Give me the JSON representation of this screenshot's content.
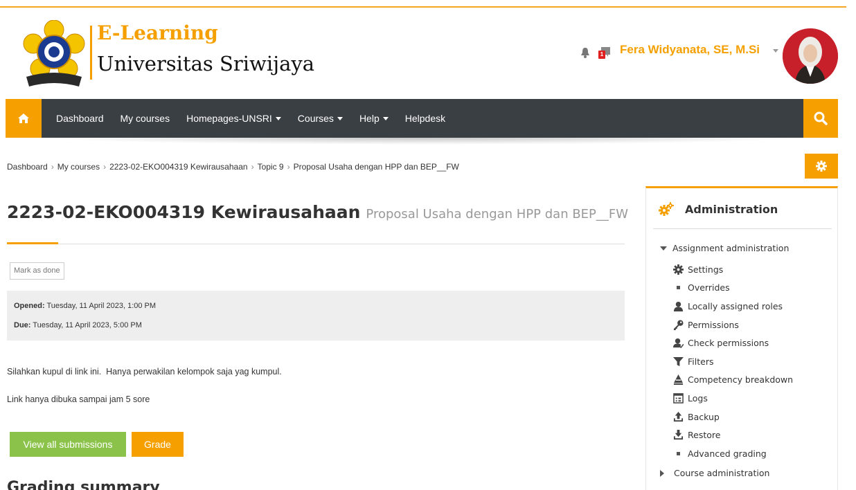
{
  "brand": {
    "title": "E-Learning",
    "subtitle": "Universitas  Sriwijaya",
    "logo_motto": "ILMU ALAT PENGABDIAN"
  },
  "header": {
    "message_badge": "1",
    "user_name": "Fera Widyanata, SE, M.Si"
  },
  "nav": {
    "items": [
      {
        "label": "Dashboard",
        "dropdown": false
      },
      {
        "label": "My courses",
        "dropdown": false
      },
      {
        "label": "Homepages-UNSRI",
        "dropdown": true
      },
      {
        "label": "Courses",
        "dropdown": true
      },
      {
        "label": "Help",
        "dropdown": true
      },
      {
        "label": "Helpdesk",
        "dropdown": false
      }
    ]
  },
  "breadcrumb": [
    "Dashboard",
    "My courses",
    "2223-02-EKO004319 Kewirausahaan",
    "Topic 9",
    "Proposal Usaha dengan HPP dan BEP__FW"
  ],
  "page": {
    "course_name": "2223-02-EKO004319 Kewirausahaan",
    "activity_name": "Proposal Usaha dengan HPP dan BEP__FW",
    "mark_done": "Mark as done",
    "opened_label": "Opened:",
    "opened_value": " Tuesday, 11 April 2023, 1:00 PM",
    "due_label": "Due:",
    "due_value": " Tuesday, 11 April 2023, 5:00 PM",
    "intro_1": "Silahkan kupul di link ini.  Hanya perwakilan kelompok saja yag kumpul.",
    "intro_2": "Link hanya dibuka sampai jam 5 sore",
    "btn_view_all": "View all submissions",
    "btn_grade": "Grade",
    "grading_summary": "Grading summary"
  },
  "admin": {
    "title": "Administration",
    "section": "Assignment administration",
    "items": [
      {
        "label": "Settings",
        "icon": "gear-icon"
      },
      {
        "label": "Overrides",
        "icon": "bullet"
      },
      {
        "label": "Locally assigned roles",
        "icon": "user-icon"
      },
      {
        "label": "Permissions",
        "icon": "key-icon"
      },
      {
        "label": "Check permissions",
        "icon": "user-check-icon"
      },
      {
        "label": "Filters",
        "icon": "filter-icon"
      },
      {
        "label": "Competency breakdown",
        "icon": "competency-icon"
      },
      {
        "label": "Logs",
        "icon": "logs-icon"
      },
      {
        "label": "Backup",
        "icon": "upload-icon"
      },
      {
        "label": "Restore",
        "icon": "download-icon"
      },
      {
        "label": "Advanced grading",
        "icon": "bullet"
      }
    ],
    "course_admin": "Course administration"
  },
  "colors": {
    "accent": "#f5a000",
    "navbar": "#3a3f44",
    "green": "#8bc34a"
  }
}
